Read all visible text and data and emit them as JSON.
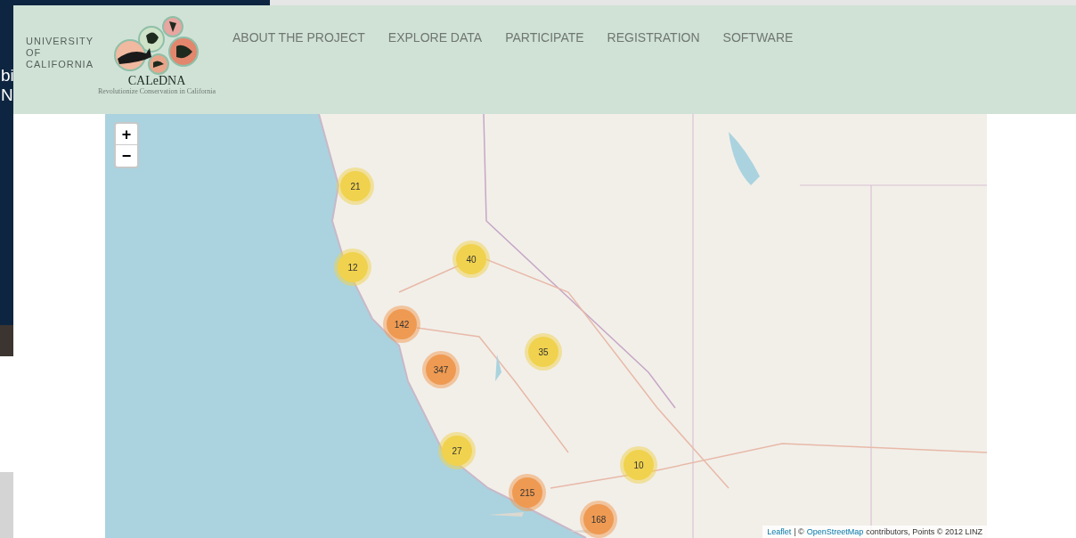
{
  "background_window": {
    "texts": [
      "bi",
      "N"
    ]
  },
  "header": {
    "university": [
      "UNIVERSITY",
      "OF",
      "CALIFORNIA"
    ],
    "logo_title": "CALeDNA",
    "logo_tagline": "Revolutionize Conservation in California",
    "nav": [
      {
        "label": "ABOUT THE PROJECT"
      },
      {
        "label": "EXPLORE DATA"
      },
      {
        "label": "PARTICIPATE"
      },
      {
        "label": "REGISTRATION"
      },
      {
        "label": "SOFTWARE"
      }
    ]
  },
  "map": {
    "zoom": [
      "+",
      "−"
    ],
    "clusters": [
      {
        "label": "21",
        "color": "#f0d24e"
      },
      {
        "label": "12",
        "color": "#f0d24e"
      },
      {
        "label": "40",
        "color": "#f0d24e"
      },
      {
        "label": "142",
        "color": "#ef9a52"
      },
      {
        "label": "347",
        "color": "#ef9a52"
      },
      {
        "label": "35",
        "color": "#f0d24e"
      },
      {
        "label": "27",
        "color": "#f0d24e"
      },
      {
        "label": "10",
        "color": "#f0d24e"
      },
      {
        "label": "215",
        "color": "#ef9a52"
      },
      {
        "label": "168",
        "color": "#ef9a52"
      }
    ],
    "attribution": {
      "leaflet": "Leaflet",
      "separator": "| ©",
      "osm": "OpenStreetMap",
      "rest": "contributors, Points © 2012 LINZ"
    }
  }
}
